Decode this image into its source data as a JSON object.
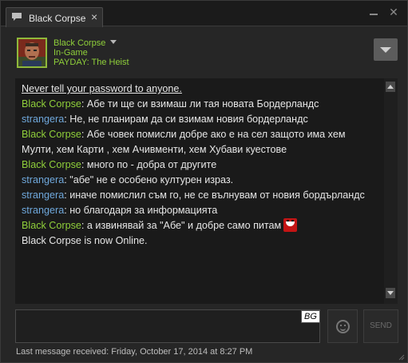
{
  "tab": {
    "label": "Black Corpse",
    "close": "×"
  },
  "window": {
    "minimize": "",
    "close": "✕"
  },
  "friend": {
    "name": "Black Corpse",
    "status": "In-Game",
    "game": "PAYDAY: The Heist"
  },
  "messages": [
    {
      "type": "system",
      "text": "Never tell your password to anyone."
    },
    {
      "type": "msg",
      "sender": "Black Corpse",
      "who": "me",
      "text": "Абе ти ще си взимаш ли тая новата Бордерландс"
    },
    {
      "type": "msg",
      "sender": "strangera",
      "who": "other",
      "text": "Не, не планирам да си взимам новия бордерландс"
    },
    {
      "type": "msg",
      "sender": "Black Corpse",
      "who": "me",
      "text": "Абе човек помисли добре ако е на сел защото има хем"
    },
    {
      "type": "cont",
      "text": "Мулти, хем Карти , хем Ачивменти, хем Хубави куестове"
    },
    {
      "type": "msg",
      "sender": "Black Corpse",
      "who": "me",
      "text": "много по - добра от другите"
    },
    {
      "type": "msg",
      "sender": "strangera",
      "who": "other",
      "text": "\"абе\" не е особено културен израз."
    },
    {
      "type": "msg",
      "sender": "strangera",
      "who": "other",
      "text": "иначе помислил съм го, не се вълнувам от новия бордърландс"
    },
    {
      "type": "msg",
      "sender": "strangera",
      "who": "other",
      "text": "но благодаря за информацията"
    },
    {
      "type": "msg",
      "sender": "Black Corpse",
      "who": "me",
      "text": "а извинявай за \"Абе\" и добре само питам",
      "emoticon": true
    },
    {
      "type": "cont",
      "text": "Black Corpse is now Online."
    }
  ],
  "input": {
    "value": "",
    "lang": "BG"
  },
  "send_label": "SEND",
  "footer": "Last message received: Friday, October 17, 2014 at 8:27 PM",
  "colors": {
    "self": "#8fcf3a",
    "other": "#6fa8dc",
    "background": "#262626"
  }
}
